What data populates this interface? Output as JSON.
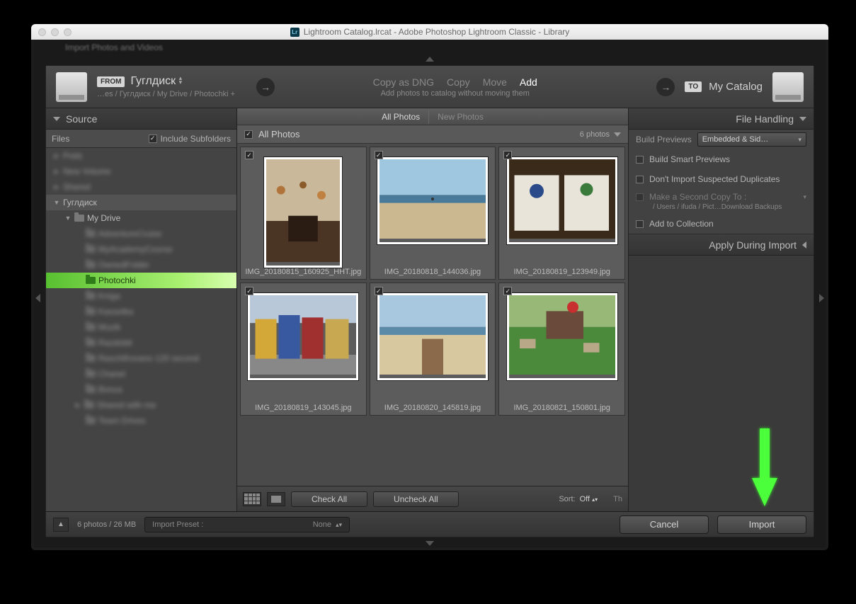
{
  "window": {
    "title": "Lightroom Catalog.lrcat - Adobe Photoshop Lightroom Classic - Library",
    "lr_badge": "Lr"
  },
  "header_hint": "Import Photos and Videos",
  "from": {
    "badge": "FROM",
    "name": "Гуглдиск",
    "breadcrumb": "…es / Гуглдиск / My Drive / Photochki +"
  },
  "actions": {
    "copy_dng": "Copy as DNG",
    "copy": "Copy",
    "move": "Move",
    "add": "Add",
    "subtitle": "Add photos to catalog without moving them"
  },
  "to": {
    "badge": "TO",
    "name": "My Catalog"
  },
  "left": {
    "source_title": "Source",
    "files_label": "Files",
    "include_subfolders": "Include Subfolders",
    "tree": {
      "root": "Гуглдиск",
      "mydrive": "My Drive",
      "blur_items": [
        "AdventureCruise",
        "MyAcademyCourse",
        "OwnedFolder"
      ],
      "selected": "Photochki",
      "blur_items2": [
        "Kniga",
        "Kassetka",
        "Muzik",
        "Razdobit",
        "Raschifrovano 120 second",
        "Chanel",
        "Bonus",
        "Shared with me",
        "Team Drives"
      ]
    }
  },
  "mid": {
    "tab_all": "All Photos",
    "tab_new": "New Photos",
    "bar_label": "All Photos",
    "count": "6 photos",
    "thumbs": [
      {
        "caption": "IMG_20180815_160925_HHT.jpg",
        "kind": "kitchen"
      },
      {
        "caption": "IMG_20180818_144036.jpg",
        "kind": "beach1"
      },
      {
        "caption": "IMG_20180819_123949.jpg",
        "kind": "mugs"
      },
      {
        "caption": "IMG_20180819_143045.jpg",
        "kind": "houses"
      },
      {
        "caption": "IMG_20180820_145819.jpg",
        "kind": "beach2"
      },
      {
        "caption": "IMG_20180821_150801.jpg",
        "kind": "park"
      }
    ],
    "check_all": "Check All",
    "uncheck_all": "Uncheck All",
    "sort_label": "Sort:",
    "sort_value": "Off",
    "thumb_size_label": "Th"
  },
  "right": {
    "file_handling": "File Handling",
    "build_previews_label": "Build Previews",
    "build_previews_value": "Embedded & Sid…",
    "smart_previews": "Build Smart Previews",
    "no_duplicates": "Don't Import Suspected Duplicates",
    "second_copy": "Make a Second Copy To :",
    "second_copy_path": "/ Users / ifuda / Pict…Download Backups",
    "add_collection": "Add to Collection",
    "apply_during": "Apply During Import"
  },
  "bottom": {
    "status": "6 photos / 26 MB",
    "preset_label": "Import Preset :",
    "preset_value": "None",
    "cancel": "Cancel",
    "import": "Import"
  }
}
